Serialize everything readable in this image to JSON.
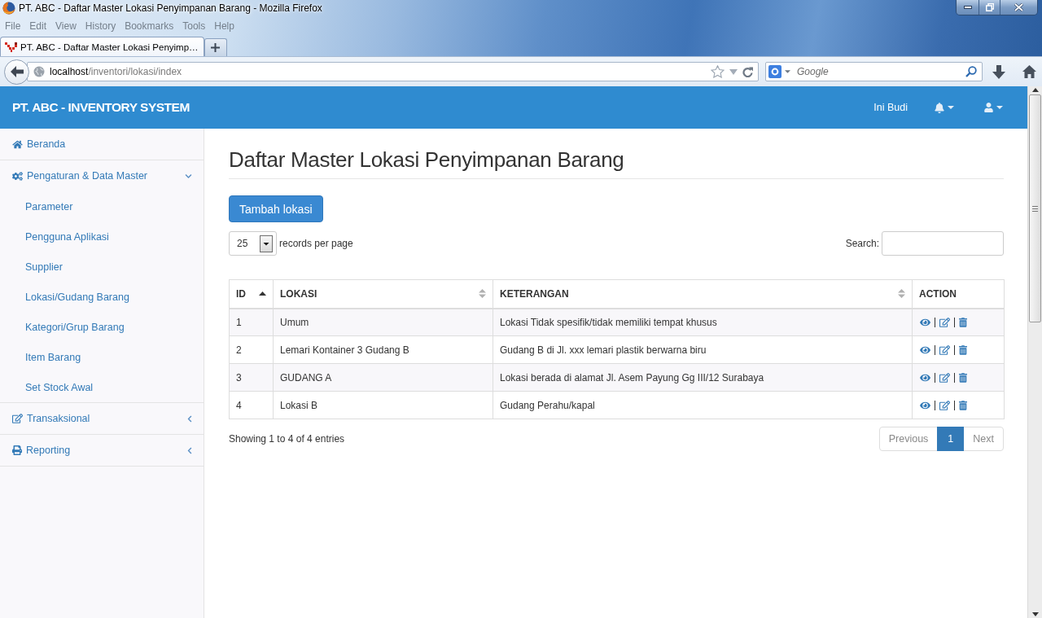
{
  "window": {
    "title": "PT. ABC - Daftar Master Lokasi Penyimpanan Barang - Mozilla Firefox"
  },
  "menu_bar": [
    "File",
    "Edit",
    "View",
    "History",
    "Bookmarks",
    "Tools",
    "Help"
  ],
  "tabs": [
    {
      "label": "PT. ABC - Daftar Master Lokasi Penyimp…",
      "selected": true
    }
  ],
  "address_bar": {
    "host": "localhost",
    "path": "/inventori/lokasi/index"
  },
  "search_bar": {
    "placeholder": "Google"
  },
  "header": {
    "brand": "PT. ABC - INVENTORY SYSTEM",
    "user_name": "Ini Budi"
  },
  "sidebar": {
    "items": [
      {
        "label": "Beranda",
        "kind": "link"
      },
      {
        "label": "Pengaturan & Data Master",
        "kind": "group",
        "expanded": true,
        "children": [
          {
            "label": "Parameter"
          },
          {
            "label": "Pengguna Aplikasi"
          },
          {
            "label": "Supplier"
          },
          {
            "label": "Lokasi/Gudang Barang"
          },
          {
            "label": "Kategori/Grup Barang"
          },
          {
            "label": "Item Barang"
          },
          {
            "label": "Set Stock Awal"
          }
        ]
      },
      {
        "label": "Transaksional",
        "kind": "group",
        "expanded": false
      },
      {
        "label": "Reporting",
        "kind": "group",
        "expanded": false
      }
    ]
  },
  "page": {
    "title": "Daftar Master Lokasi Penyimpanan Barang",
    "add_button": "Tambah lokasi",
    "page_length": {
      "value": "25",
      "label": "records per page"
    },
    "search": {
      "label": "Search:"
    }
  },
  "table": {
    "columns": [
      {
        "label": "ID",
        "sortable": true,
        "sorted": true
      },
      {
        "label": "LOKASI",
        "sortable": true,
        "sorted": false
      },
      {
        "label": "KETERANGAN",
        "sortable": true,
        "sorted": false
      },
      {
        "label": "ACTION",
        "sortable": false,
        "sorted": false
      }
    ],
    "rows": [
      {
        "cells": [
          "1",
          "Umum",
          "Lokasi Tidak spesifik/tidak memiliki tempat khusus"
        ]
      },
      {
        "cells": [
          "2",
          "Lemari Kontainer 3 Gudang B",
          "Gudang B di Jl. xxx lemari plastik berwarna biru"
        ]
      },
      {
        "cells": [
          "3",
          "GUDANG A",
          "Lokasi berada di alamat Jl. Asem Payung Gg III/12 Surabaya"
        ]
      },
      {
        "cells": [
          "4",
          "Lokasi B",
          "Gudang Perahu/kapal"
        ]
      }
    ]
  },
  "table_info": "Showing 1 to 4 of 4 entries",
  "pagination": {
    "previous": {
      "label": "Previous",
      "disabled": true
    },
    "pages": [
      {
        "label": "1",
        "selected": true
      }
    ],
    "next": {
      "label": "Next",
      "disabled": true
    }
  }
}
